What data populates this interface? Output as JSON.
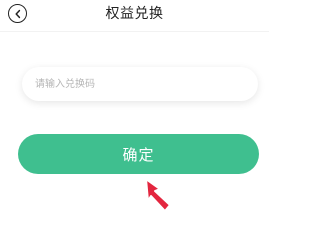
{
  "header": {
    "title": "权益兑换",
    "back_icon": "chevron-left-icon"
  },
  "redeem": {
    "input_value": "",
    "input_placeholder": "请输入兑换码",
    "confirm_label": "确定"
  },
  "colors": {
    "accent": "#3fbf8f",
    "annotation_arrow": "#e3263f"
  }
}
